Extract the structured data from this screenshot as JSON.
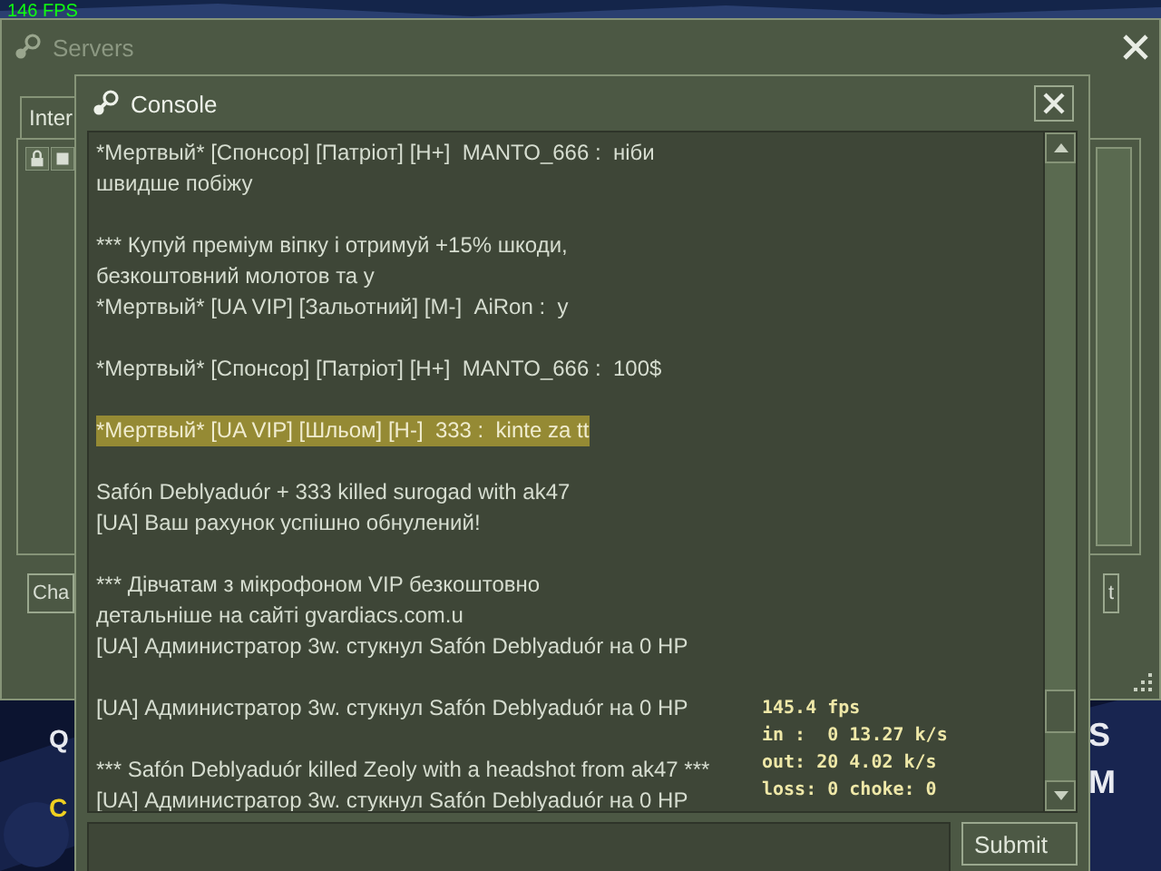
{
  "fps": "146 FPS",
  "game_menu": [
    {
      "text": "Q",
      "kind": "left"
    },
    {
      "text": "C",
      "kind": "yellow"
    },
    {
      "text": "S",
      "kind": "right"
    },
    {
      "text": "M",
      "kind": "right"
    }
  ],
  "servers_window": {
    "title": "Servers",
    "active": false,
    "tabs": [
      {
        "label": "Inter",
        "selected": true
      }
    ],
    "buttons": [
      "Cha",
      "t"
    ]
  },
  "console": {
    "title": "Console",
    "active": true,
    "blocks": [
      [
        {
          "text": "*Мертвый* [Спонсор] [Патріот] [Н+]  MANTO_666 :  ніби",
          "highlighted": false
        },
        {
          "text": "швидше побіжу",
          "highlighted": false
        }
      ],
      [
        {
          "text": "*** Купуй преміум віпку і отримуй +15% шкоди,",
          "highlighted": false
        },
        {
          "text": "безкоштовний молотов та у",
          "highlighted": false
        },
        {
          "text": "*Мертвый* [UA VIP] [Зальотний] [М-]  AiRon :  у",
          "highlighted": false
        }
      ],
      [
        {
          "text": "*Мертвый* [Спонсор] [Патріот] [Н+]  MANTO_666 :  100$",
          "highlighted": false
        }
      ],
      [
        {
          "text": "*Мертвый* [UA VIP] [Шльом] [Н-]  333 :  kinte za tt",
          "highlighted": true
        }
      ],
      [
        {
          "text": "Safón Deblyaduór + 333 killed surogad with ak47",
          "highlighted": false
        },
        {
          "text": "[UA] Ваш рахунок успішно обнулений!",
          "highlighted": false
        }
      ],
      [
        {
          "text": "*** Дівчатам з мікрофоном VIP безкоштовно",
          "highlighted": false
        },
        {
          "text": "детальніше на сайті gvardiacs.com.u",
          "highlighted": false
        },
        {
          "text": "[UA] Администратор 3w. стукнул Safón Deblyaduór на 0 HP",
          "highlighted": false
        }
      ],
      [
        {
          "text": "[UA] Администратор 3w. стукнул Safón Deblyaduór на 0 HP",
          "highlighted": false
        }
      ],
      [
        {
          "text": "*** Safón Deblyaduór killed Zeoly with a headshot from ak47 ***",
          "highlighted": false
        },
        {
          "text": "[UA] Администратор 3w. стукнул Safón Deblyaduór на 0 HP",
          "highlighted": false
        }
      ]
    ],
    "submit": "Submit"
  },
  "net_graph": [
    "145.4 fps",
    "in :  0 13.27 k/s",
    "out: 20 4.02 k/s",
    "loss: 0 choke: 0"
  ]
}
